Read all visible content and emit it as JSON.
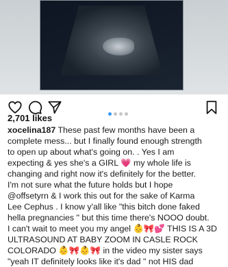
{
  "post": {
    "likes": "2,701 likes",
    "username": "xocelina187",
    "caption_lines": [
      " These past few months have been a",
      "complete mess... but I finally found enough strength",
      "to open up about what's going on. . Yes I am",
      "expecting & yes she's a GIRL 💗 my whole life is",
      "changing and right now it's definitely for the better.",
      "I'm not sure what the future holds but I hope",
      "@offsetyrn & I work this out for the sake of Karma",
      "Lee Cephus . I know y'all like \"this bitch done faked",
      "hella pregnancies \" but this time there's NOOO doubt.",
      "I can't wait to meet you my angel 👶🎀💕 THIS IS A 3D",
      "ULTRASOUND AT BABY ZOOM IN CASLE ROCK",
      "COLORADO 👶🎀👶🎀 in the video my sister says",
      "\"yeah IT definitely looks like it's dad \" not HIS dad"
    ]
  },
  "icons": {
    "like": "heart-icon",
    "comment": "comment-icon",
    "share": "send-icon",
    "save": "bookmark-icon"
  },
  "carousel": {
    "total": 4,
    "active_index": 0
  },
  "colors": {
    "carousel_active": "#3897f0",
    "carousel_inactive": "#c5c5c5"
  }
}
